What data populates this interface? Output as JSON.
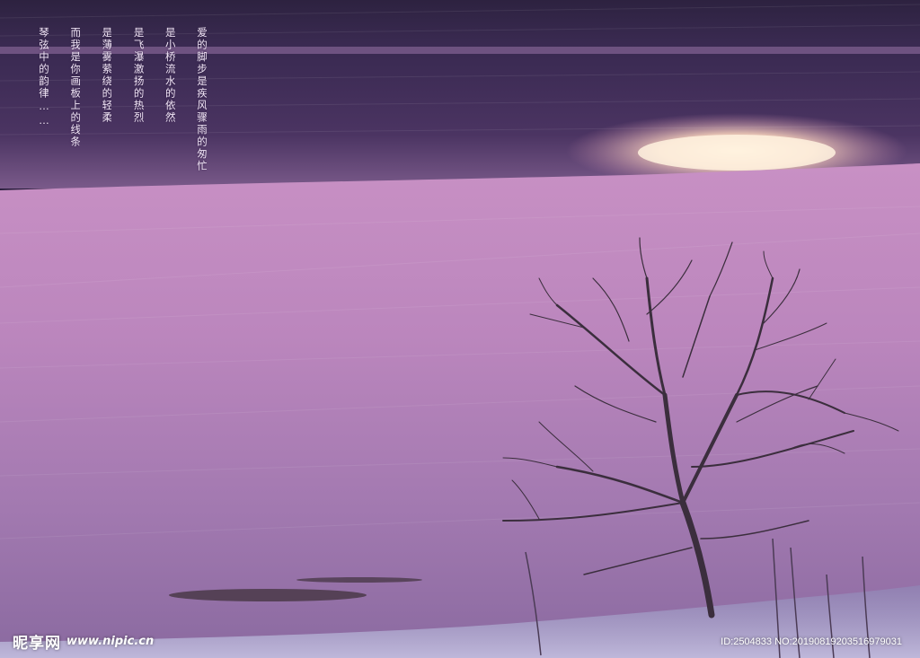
{
  "poem": {
    "lines": [
      "爱的脚步是疾风骤雨的匆忙",
      "是小桥流水的依然",
      "是飞瀑激扬的热烈",
      "是薄雾萦绕的轻柔",
      "而我是你画板上的线条",
      "琴弦中的韵律……"
    ]
  },
  "watermark": {
    "brand": "昵享网",
    "url": "www.nipic.cn",
    "image_id": "ID:2504833 NO:20190819203516979031"
  },
  "colors": {
    "sky_top": "#2f2540",
    "water_dark": "#3a2750",
    "water_pink": "#c690c2",
    "water_lilac": "#a77db6",
    "glow": "#ffe9c8",
    "tree": "#3b2e3d"
  }
}
